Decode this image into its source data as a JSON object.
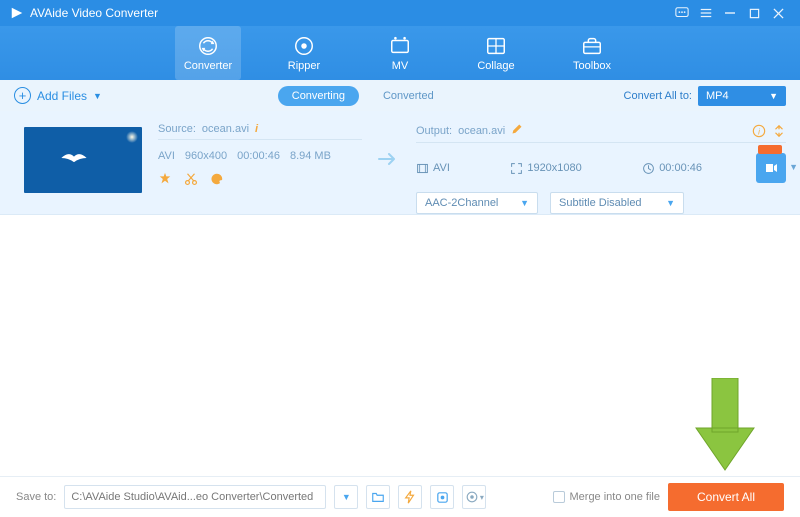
{
  "app": {
    "title": "AVAide Video Converter"
  },
  "nav": {
    "items": [
      {
        "label": "Converter"
      },
      {
        "label": "Ripper"
      },
      {
        "label": "MV"
      },
      {
        "label": "Collage"
      },
      {
        "label": "Toolbox"
      }
    ]
  },
  "toolbar": {
    "add_files": "Add Files",
    "tab_converting": "Converting",
    "tab_converted": "Converted",
    "convert_all_to": "Convert All to:",
    "format": "MP4"
  },
  "item": {
    "source_label": "Source:",
    "source_file": "ocean.avi",
    "src_fmt": "AVI",
    "src_res": "960x400",
    "src_dur": "00:00:46",
    "src_size": "8.94 MB",
    "output_label": "Output:",
    "output_file": "ocean.avi",
    "out_fmt": "AVI",
    "out_res": "1920x1080",
    "out_dur": "00:00:46",
    "audio_dd": "AAC-2Channel",
    "subtitle_dd": "Subtitle Disabled"
  },
  "footer": {
    "save_to_label": "Save to:",
    "path": "C:\\AVAide Studio\\AVAid...eo Converter\\Converted",
    "merge_label": "Merge into one file",
    "convert_all": "Convert All"
  }
}
